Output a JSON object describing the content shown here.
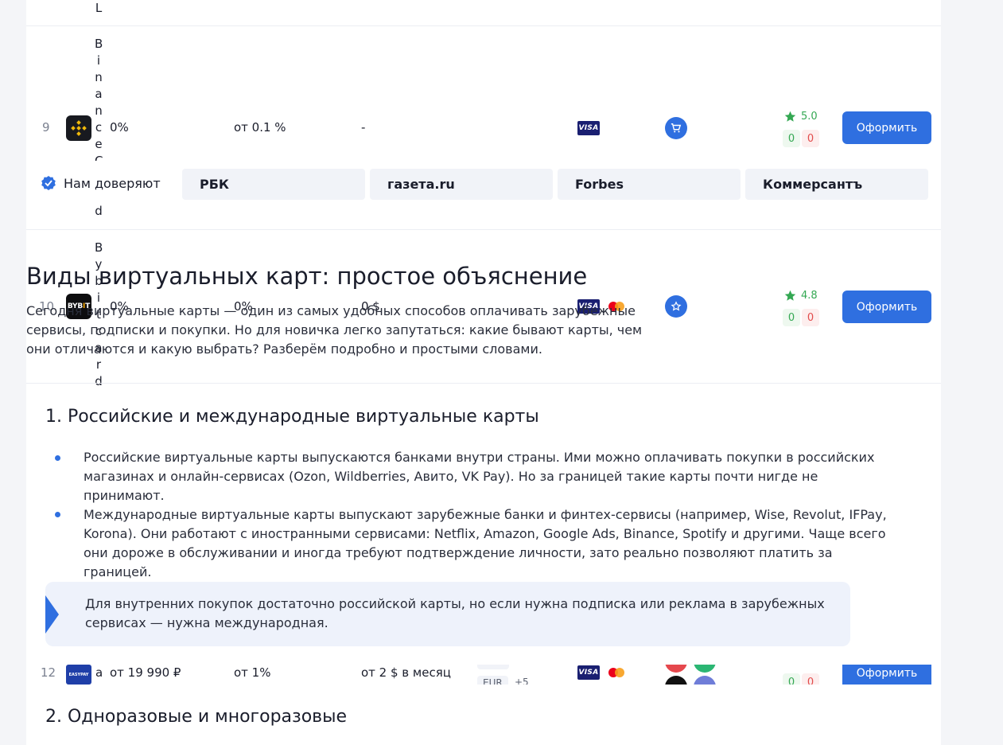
{
  "rows": [
    {
      "index": "9",
      "name_letters": [
        "B",
        "i",
        "n",
        "a",
        "n",
        "c",
        "e",
        "C",
        "a",
        "r",
        "d"
      ],
      "cashback": "0%",
      "fee": "от 0.1 %",
      "maintenance": "-",
      "rating": "5.0",
      "votes_up": "0",
      "votes_down": "0",
      "action": "Оформить"
    },
    {
      "index": "10",
      "name_letters": [
        "B",
        "y",
        "b",
        "i",
        "t",
        "c",
        "a",
        "r",
        "d"
      ],
      "cashback": "0%",
      "fee": "0%",
      "maintenance": "0 $",
      "rating": "4.8",
      "votes_up": "0",
      "votes_down": "0",
      "action": "Оформить"
    },
    {
      "index": "12",
      "name_letter": "a",
      "cashback": "от 19 990 ₽",
      "fee": "от 1%",
      "maintenance": "от 2 $ в месяц",
      "currency_chip": "EUR",
      "currency_more": "+5",
      "rating": "",
      "votes_up": "0",
      "votes_down": "0",
      "action": "Оформить"
    }
  ],
  "prev_row_tail_letter": "L",
  "trust": {
    "label": "Нам доверяют",
    "media": [
      "РБК",
      "газета.ru",
      "Forbes",
      "Коммерсантъ"
    ]
  },
  "article": {
    "title": "Виды виртуальных карт: простое объяснение",
    "intro": "Сегодня виртуальные карты — один из самых удобных способов оплачивать зарубежные сервисы, подписки и покупки. Но для новичка легко запутаться: какие бывают карты, чем они отличаются и какую выбрать? Разберём подробно и простыми словами.",
    "section1": {
      "heading": "1. Российские и международные виртуальные карты",
      "bullets": [
        "Российские виртуальные карты выпускаются банками внутри страны. Ими можно оплачивать покупки в российских магазинах и онлайн-сервисах (Ozon, Wildberries, Авито, VK Pay). Но за границей такие карты почти нигде не принимают.",
        "Международные виртуальные карты выпускают зарубежные банки и финтех-сервисы (например, Wise, Revolut, IFPay, Korona). Они работают с иностранными сервисами: Netflix, Amazon, Google Ads, Binance, Spotify и другими. Чаще всего они дороже в обслуживании и иногда требуют подтверждение личности, зато реально позволяют платить за границей."
      ],
      "callout": "Для внутренних покупок достаточно российской карты, но если нужна подписка или реклама в зарубежных сервисах — нужна международная."
    },
    "section2": {
      "heading": "2. Одноразовые и многоразовые"
    }
  },
  "colors": {
    "accent": "#2f6fe0",
    "positive": "#34a853",
    "negative": "#e24b4b"
  }
}
